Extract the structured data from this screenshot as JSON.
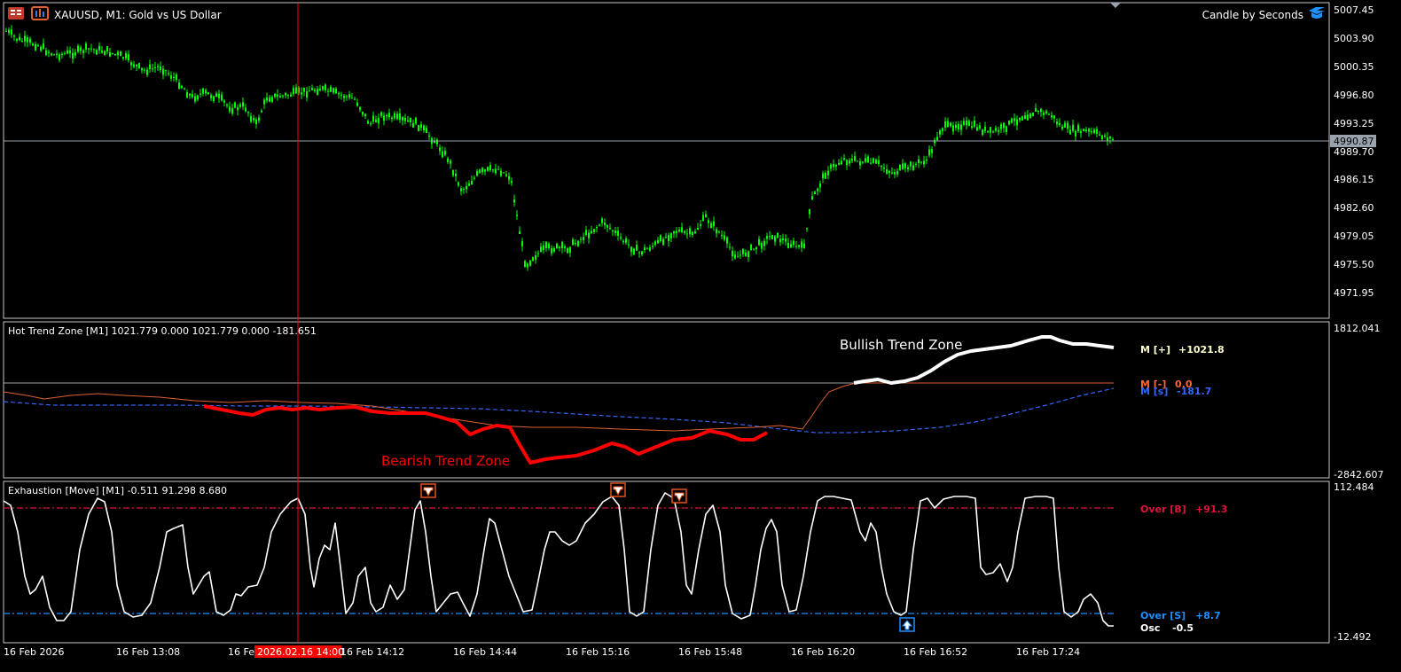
{
  "symbol_title": "XAUUSD, M1:  Gold vs US Dollar",
  "brand_label": "Candle by Seconds",
  "price_axis": {
    "ticks": [
      "5007.45",
      "5003.90",
      "5000.35",
      "4996.80",
      "4993.25",
      "4989.70",
      "4986.15",
      "4982.60",
      "4979.05",
      "4975.50",
      "4971.95"
    ],
    "current_price": "4990.87"
  },
  "hot_trend": {
    "title": "Hot Trend Zone [M1] 1021.779 0.000 1021.779 0.000 -181.651",
    "axis_top": "1812.041",
    "axis_bottom": "-2842.607",
    "bullish_label": "Bullish Trend Zone",
    "bearish_label": "Bearish Trend Zone",
    "m_plus_label": "M [+]",
    "m_plus_value": "+1021.8",
    "m_minus_label": "M [-]",
    "m_minus_value": "0.0",
    "m_s_label": "M [s]",
    "m_s_value": "-181.7"
  },
  "exhaustion": {
    "title": "Exhaustion [Move] [M1] -0.511 91.298 8.680",
    "axis_top": "112.484",
    "axis_bottom": "-12.492",
    "over_b_label": "Over [B]",
    "over_b_value": "+91.3",
    "over_s_label": "Over [S]",
    "over_s_value": "+8.7",
    "osc_label": "Osc",
    "osc_value": "-0.5"
  },
  "time_axis": {
    "labels": [
      "16 Feb 2026",
      "16 Feb 13:08",
      "16 Feb",
      "16 Feb 14:12",
      "16 Feb 14:44",
      "16 Feb 15:16",
      "16 Feb 15:48",
      "16 Feb 16:20",
      "16 Feb 16:52",
      "16 Feb 17:24"
    ],
    "crosshair_label": "2026.02.16 14:00"
  },
  "colors": {
    "bull_candle": "#00ff00",
    "trend_line": "#ff0000",
    "bull_zone": "#ffffff",
    "m_plus": "#ffffcc",
    "m_minus": "#ff6633",
    "m_s": "#3366ff",
    "over_b": "#dc143c",
    "over_s": "#1e90ff",
    "crosshair": "#ff0000"
  }
}
